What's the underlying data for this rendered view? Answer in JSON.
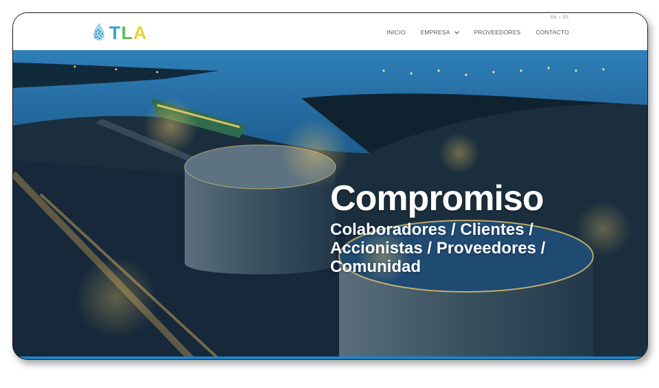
{
  "header": {
    "logo_text": "TLA",
    "lang": {
      "en": "EN",
      "sep": "|",
      "es": "ES"
    },
    "nav": [
      {
        "label": "INICIO"
      },
      {
        "label": "EMPRESA"
      },
      {
        "label": "PROVEEDORES"
      },
      {
        "label": "CONTACTO"
      }
    ]
  },
  "hero": {
    "headline": "Compromiso",
    "subline": "Colaboradores / Clientes / Accionistas / Proveedores / Comunidad"
  },
  "colors": {
    "accent": "#1d83c8",
    "logo_t": "#3aa0cc",
    "logo_l": "#5cbf57",
    "logo_a": "#e6d53a"
  }
}
